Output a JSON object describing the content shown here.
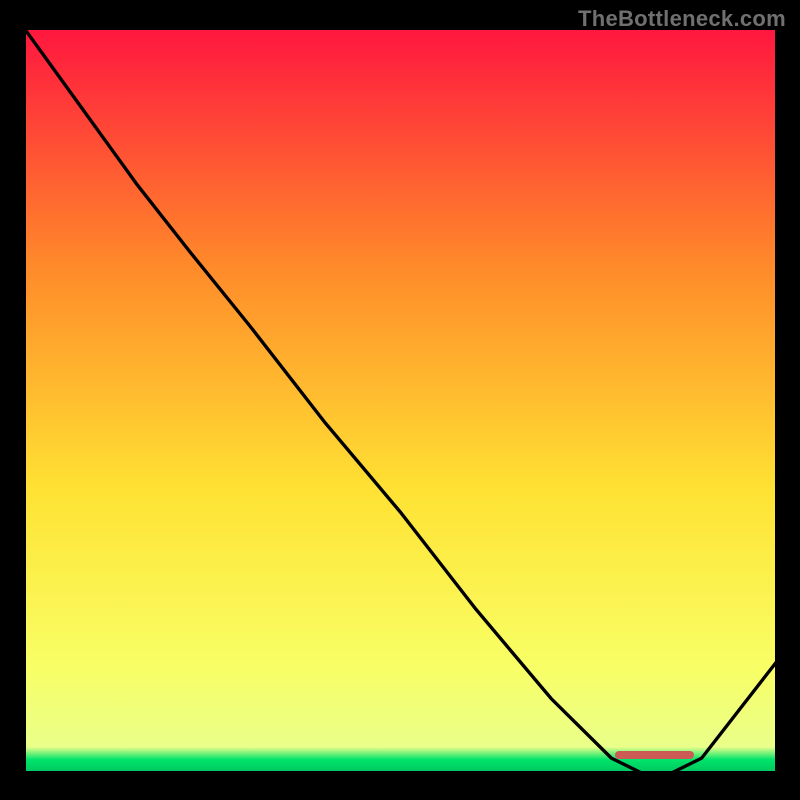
{
  "watermark": "TheBottleneck.com",
  "colors": {
    "top": "#ff163f",
    "upper_mid": "#ff8a2a",
    "mid": "#ffe233",
    "lower_mid": "#f8ff66",
    "green": "#00e46a",
    "curve": "#000000",
    "band": "#cc5a55"
  },
  "chart_data": {
    "type": "line",
    "title": "",
    "xlabel": "",
    "ylabel": "",
    "xlim": [
      0,
      100
    ],
    "ylim": [
      0,
      100
    ],
    "x": [
      0,
      5,
      10,
      15,
      22,
      30,
      40,
      50,
      60,
      70,
      78,
      82,
      86,
      90,
      100
    ],
    "values": [
      100,
      93,
      86,
      79,
      70,
      60,
      47,
      35,
      22,
      10,
      2,
      0,
      0,
      2,
      15
    ],
    "sweet_range_x": [
      78.5,
      89
    ]
  }
}
